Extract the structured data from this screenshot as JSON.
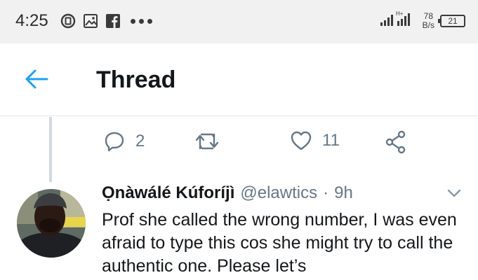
{
  "status_bar": {
    "time": "4:25",
    "icons": [
      "data-saver-icon",
      "gallery-icon",
      "facebook-icon",
      "more-dots-icon"
    ],
    "network_speed_value": "78",
    "network_speed_unit": "B/s",
    "battery": "21"
  },
  "header": {
    "title": "Thread",
    "back_icon": "arrow-left-icon",
    "accent_color": "#1da1f2"
  },
  "actions": {
    "reply_count": "2",
    "retweet_count": "",
    "like_count": "11",
    "icons": [
      "reply-icon",
      "retweet-icon",
      "like-icon",
      "share-icon"
    ]
  },
  "tweet": {
    "author_name": "Ọnàwálé Kúforíjì",
    "author_handle": "@elawtics",
    "separator": "·",
    "time": "9h",
    "text": "Prof she called the wrong number, I was even afraid to type this cos she might try to call the authentic one. Please let’s"
  }
}
